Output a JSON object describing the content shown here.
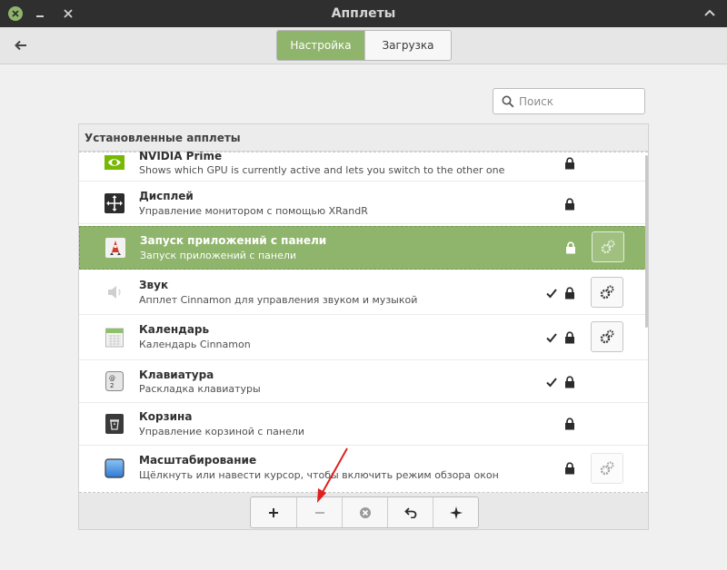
{
  "window": {
    "title": "Апплеты"
  },
  "tabs": [
    {
      "label": "Настройка",
      "active": true
    },
    {
      "label": "Загрузка",
      "active": false
    }
  ],
  "search": {
    "placeholder": "Поиск",
    "value": ""
  },
  "list": {
    "header": "Установленные апплеты",
    "items": [
      {
        "name": "NVIDIA Prime",
        "desc": "Shows which GPU is currently active and lets you switch to the other one",
        "icon": "nvidia-icon",
        "enabled": false,
        "configurable": false
      },
      {
        "name": "Дисплей",
        "desc": "Управление монитором с помощью XRandR",
        "icon": "display-icon",
        "enabled": false,
        "configurable": false
      },
      {
        "name": "Запуск приложений с панели",
        "desc": "Запуск приложений с панели",
        "icon": "launcher-icon",
        "enabled": false,
        "configurable": true,
        "selected": true
      },
      {
        "name": "Звук",
        "desc": "Апплет Cinnamon для управления звуком и музыкой",
        "icon": "speaker-icon",
        "enabled": true,
        "configurable": true
      },
      {
        "name": "Календарь",
        "desc": "Календарь Cinnamon",
        "icon": "calendar-icon",
        "enabled": true,
        "configurable": true
      },
      {
        "name": "Клавиатура",
        "desc": "Раскладка клавиатуры",
        "icon": "keyboard-icon",
        "enabled": true,
        "configurable": false
      },
      {
        "name": "Корзина",
        "desc": "Управление корзиной с панели",
        "icon": "trash-icon",
        "enabled": false,
        "configurable": false
      },
      {
        "name": "Масштабирование",
        "desc": "Щёлкнуть или навести курсор, чтобы включить режим обзора окон",
        "icon": "scale-icon",
        "enabled": false,
        "configurable": true,
        "configDisabled": true
      }
    ]
  },
  "toolbar": {
    "buttons": [
      "add-icon",
      "remove-icon",
      "close-circle-icon",
      "undo-icon",
      "sparkle-icon"
    ]
  },
  "colors": {
    "accent": "#8fb46c",
    "titlebar": "#2f2f2f",
    "annotation": "#e02020"
  }
}
